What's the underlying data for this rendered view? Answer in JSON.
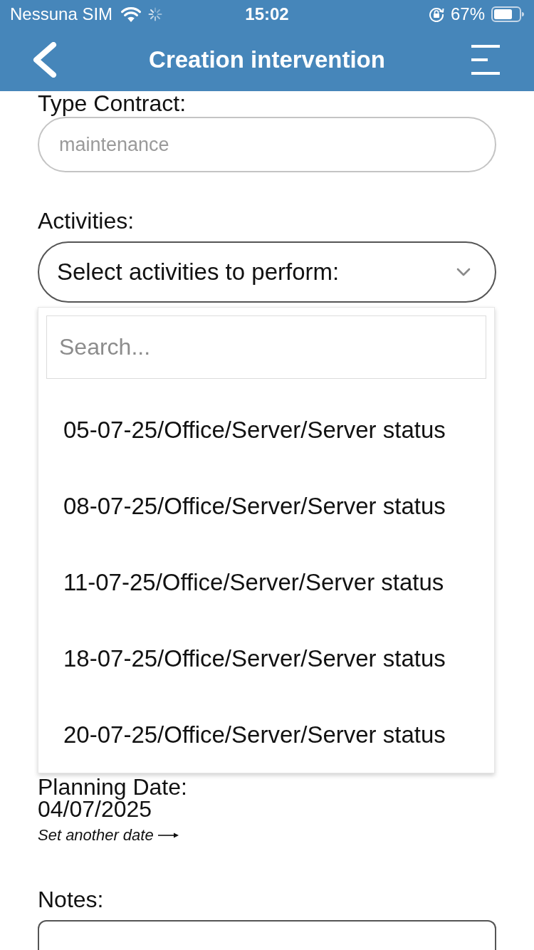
{
  "status_bar": {
    "carrier": "Nessuna SIM",
    "time": "15:02",
    "battery": "67%"
  },
  "header": {
    "title": "Creation intervention"
  },
  "form": {
    "type_contract": {
      "label": "Type Contract:",
      "value": "maintenance",
      "disabled": true
    },
    "activities": {
      "label": "Activities:",
      "prompt": "Select activities to perform:",
      "expanded": true,
      "search": {
        "placeholder": "Search..."
      },
      "options": [
        {
          "label": "05-07-25/Office/Server/Server status",
          "selected": false
        },
        {
          "label": "08-07-25/Office/Server/Server status",
          "selected": false
        },
        {
          "label": "11-07-25/Office/Server/Server status",
          "selected": false
        },
        {
          "label": "18-07-25/Office/Server/Server status",
          "selected": false
        },
        {
          "label": "20-07-25/Office/Server/Server status",
          "selected": false
        }
      ]
    },
    "planning_date": {
      "label": "Planning Date:",
      "value": "04/07/2025",
      "link": "Set another date"
    },
    "notes": {
      "label": "Notes:"
    }
  }
}
